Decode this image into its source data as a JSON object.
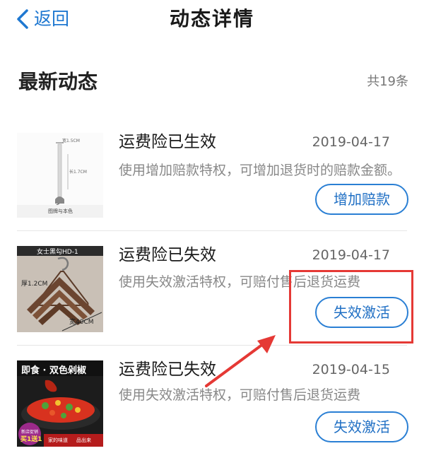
{
  "nav": {
    "back_label": "返回",
    "title": "动态详情"
  },
  "section": {
    "title": "最新动态",
    "count": "共19条"
  },
  "items": [
    {
      "title": "运费险已生效",
      "date": "2019-04-17",
      "desc": "使用增加赔款特权，可增加退货时的赔款金额。",
      "button": "增加赔款",
      "thumb_caption": "图牌与本色",
      "thumb_texts": [
        "宽1.5CM",
        "长1.7CM"
      ]
    },
    {
      "title": "运费险已失效",
      "date": "2019-04-17",
      "desc": "使用失效激活特权，可赔付售后退货运费",
      "button": "失效激活",
      "thumb_caption": "女士黑勾HD-1",
      "thumb_texts": [
        "厚1.2CM",
        "宽40CM"
      ]
    },
    {
      "title": "运费险已失效",
      "date": "2019-04-15",
      "desc": "使用失效激活特权，可赔付售后退货运费",
      "button": "失效激活",
      "thumb_caption": "即食 · 双色剁椒",
      "thumb_texts": [
        "新店促销",
        "买1送1",
        "家的味道",
        "品出来"
      ]
    }
  ],
  "colors": {
    "accent": "#1f78d1",
    "annotation": "#e53935"
  }
}
